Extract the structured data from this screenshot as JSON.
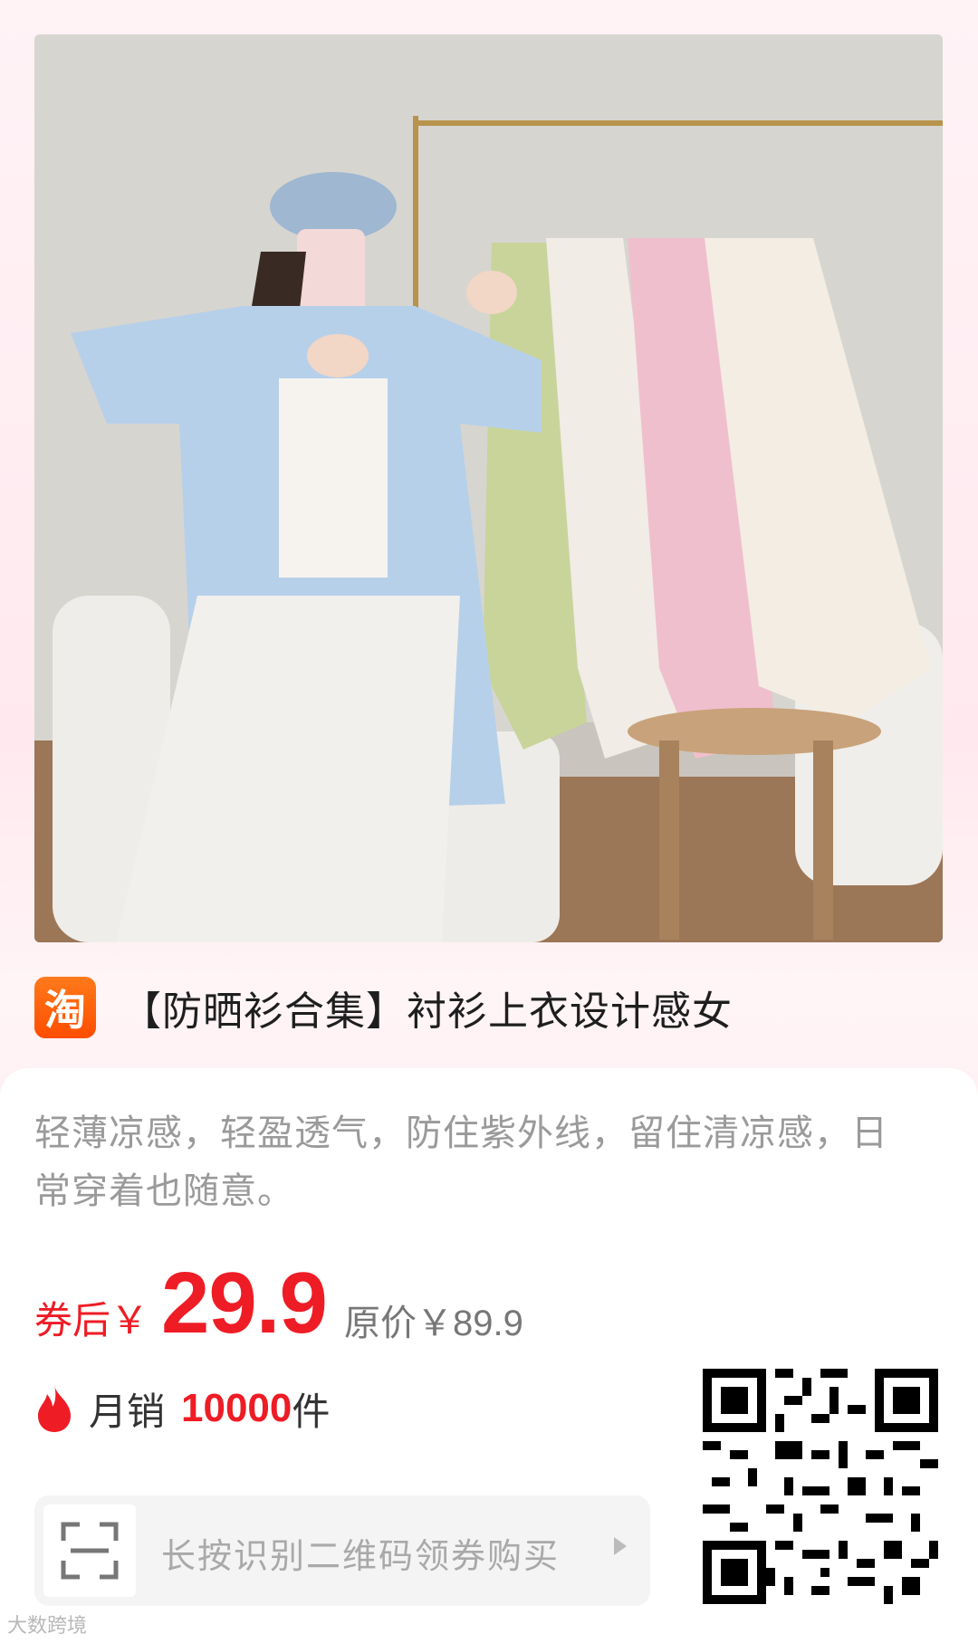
{
  "product": {
    "platform_logo_char": "淘",
    "title": "【防晒衫合集】衬衫上衣设计感女",
    "description": "轻薄凉感，轻盈透气，防住紫外线，留住清凉感，日常穿着也随意。",
    "price_prefix": "券后￥",
    "price": "29.9",
    "original_price": "原价￥89.9",
    "sales_label": "月销",
    "sales_count": "10000",
    "sales_unit": "件"
  },
  "cta": {
    "scan_text": "长按识别二维码领券购买"
  },
  "watermark": "大数跨境",
  "colors": {
    "price_red": "#ee1c25",
    "taobao_orange": "#ff5a00"
  },
  "icons": [
    "taobao-logo-icon",
    "fire-icon",
    "scan-frame-icon",
    "chevron-right-icon",
    "qr-code"
  ]
}
